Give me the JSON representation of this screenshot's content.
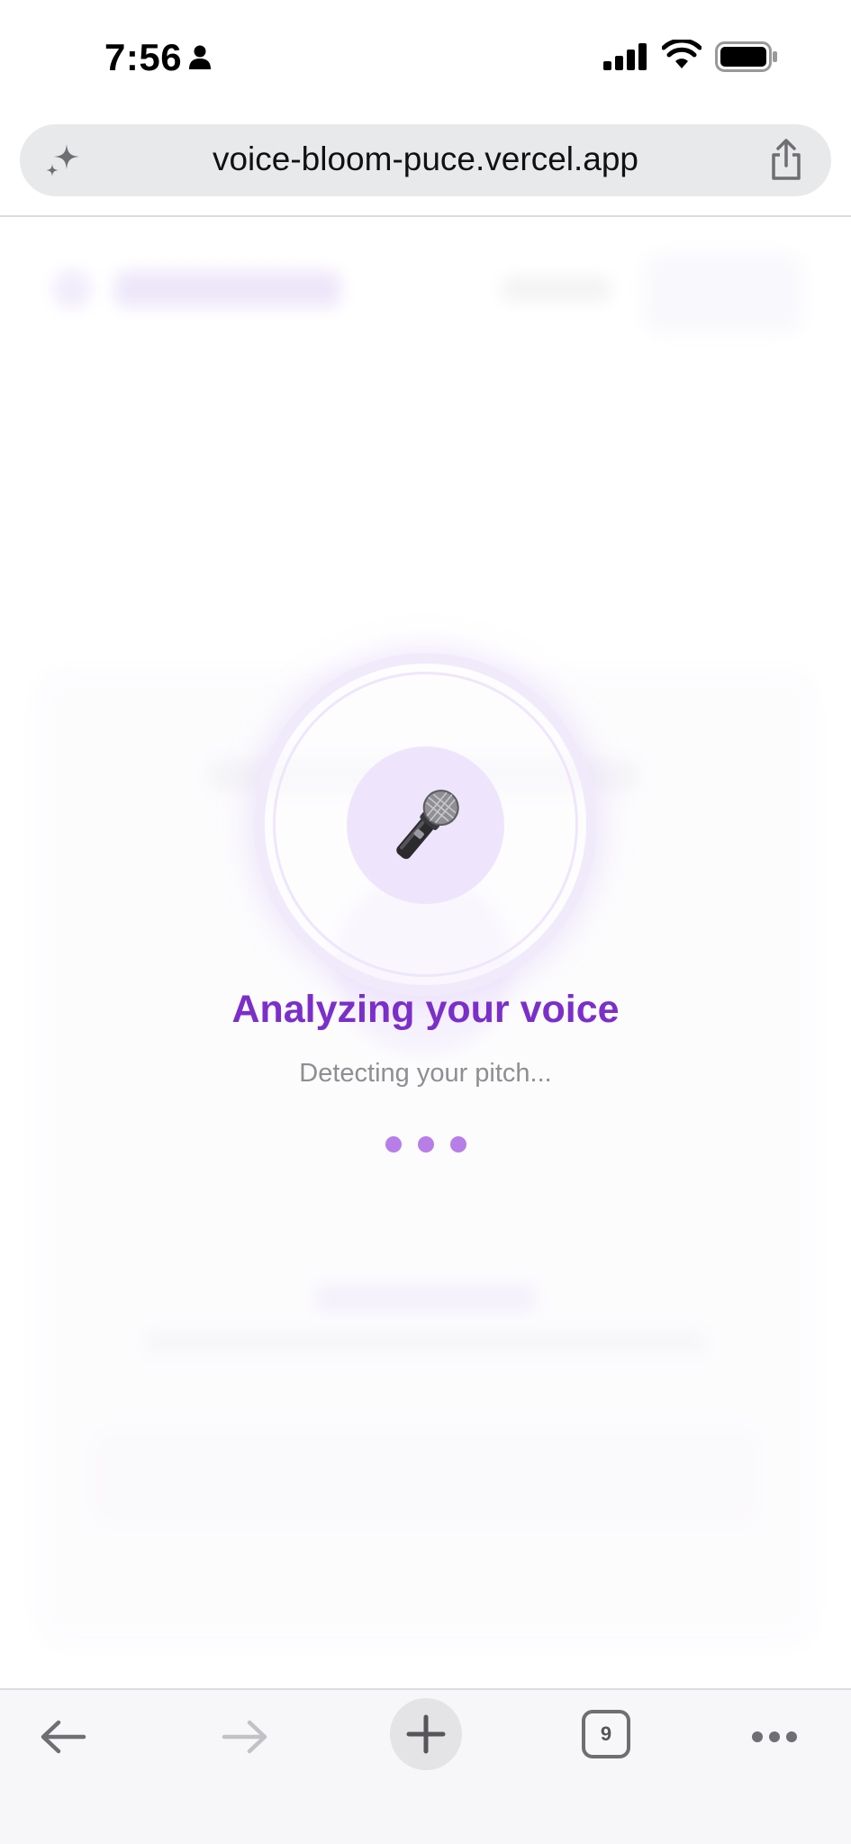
{
  "status_bar": {
    "time": "7:56"
  },
  "browser": {
    "url": "voice-bloom-puce.vercel.app",
    "tab_count": "9"
  },
  "analyzing": {
    "title": "Analyzing your voice",
    "subtitle": "Detecting your pitch...",
    "icon": "microphone-icon"
  },
  "colors": {
    "accent": "#7b2fc9",
    "dots": "#b77ee8",
    "mic_circle": "#eee5fc"
  }
}
